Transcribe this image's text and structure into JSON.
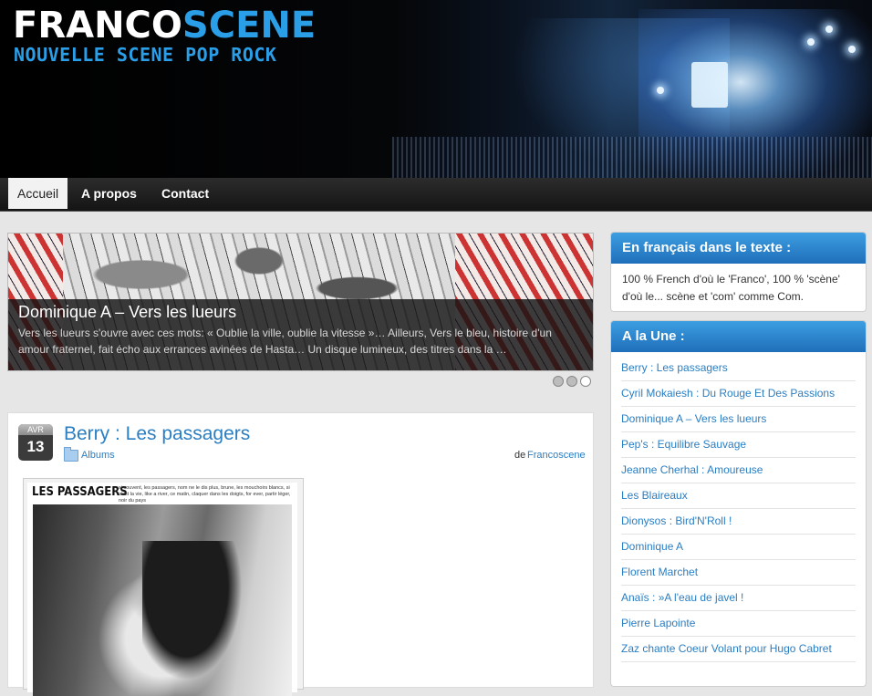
{
  "header": {
    "logo_part1": "FRANCO",
    "logo_part2": "SCENE",
    "tagline": "NOUVELLE SCENE POP ROCK"
  },
  "nav": {
    "items": [
      {
        "label": "Accueil",
        "active": true
      },
      {
        "label": "A propos",
        "active": false
      },
      {
        "label": "Contact",
        "active": false
      }
    ]
  },
  "slider": {
    "title": "Dominique A – Vers les lueurs",
    "excerpt": "Vers les lueurs s'ouvre avec ces mots: « Oublie la ville, oublie la vitesse »… Ailleurs, Vers le bleu, histoire d'un amour fraternel, fait écho aux errances avinées de Hasta… Un disque lumineux, des titres dans la …",
    "active_slide": 3,
    "slide_count": 3
  },
  "post": {
    "date_month": "AVR",
    "date_day": "13",
    "title": "Berry : Les passagers",
    "category": "Albums",
    "author_prefix": "de",
    "author": "Francoscene",
    "album_title": "LES PASSAGERS",
    "album_lyrics": "si souvent, les passagers, nom ne le dis plus, brune, les mouchoirs blancs, si c'est la vie, like a river, ce matin, claquer dans les doigts, for ever, partir léger, noir du pays"
  },
  "sidebar": {
    "widget1": {
      "title": "En français dans le texte :",
      "text": "100 % French d'où le 'Franco', 100 % 'scène' d'où le... scène et 'com' comme Com."
    },
    "widget2": {
      "title": "A la Une :",
      "links": [
        "Berry : Les passagers",
        "Cyril Mokaiesh : Du Rouge Et Des Passions",
        "Dominique A – Vers les lueurs",
        "Pep's : Equilibre Sauvage",
        "Jeanne Cherhal : Amoureuse",
        "Les Blaireaux",
        "Dionysos : Bird'N'Roll !",
        "Dominique A",
        "Florent Marchet",
        "Anaïs :  »A l'eau de javel !",
        "Pierre Lapointe",
        "Zaz chante Coeur Volant pour Hugo Cabret"
      ]
    }
  }
}
